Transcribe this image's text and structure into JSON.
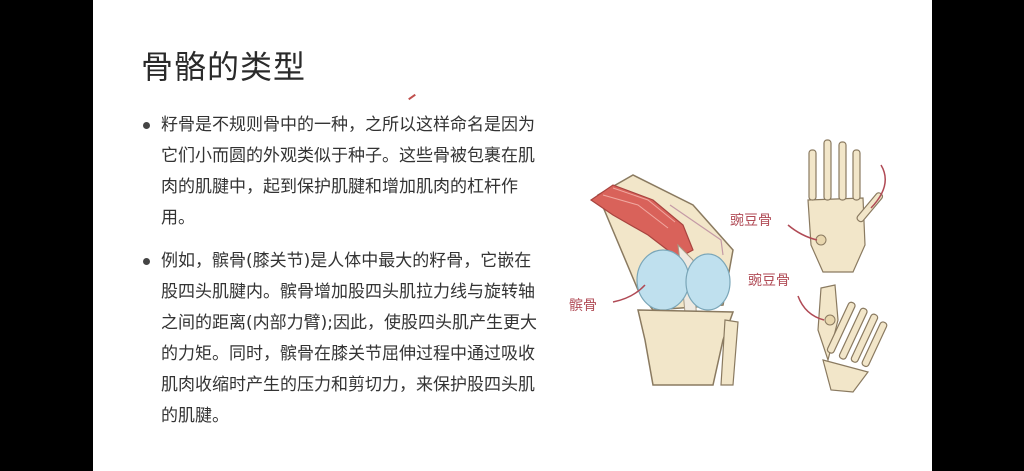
{
  "slide": {
    "title": "骨骼的类型",
    "bullets": [
      "籽骨是不规则骨中的一种，之所以这样命名是因为它们小而圆的外观类似于种子。这些骨被包裹在肌肉的肌腱中，起到保护肌腱和增加肌肉的杠杆作用。",
      "例如，髌骨(膝关节)是人体中最大的籽骨，它嵌在股四头肌腱内。髌骨增加股四头肌拉力线与旋转轴之间的距离(内部力臂);因此，使股四头肌产生更大的力矩。同时，髌骨在膝关节屈伸过程中通过吸收肌肉收缩时产生的压力和剪切力，来保护股四头肌的肌腱。"
    ]
  },
  "illustration": {
    "knee_label": "髌骨",
    "hand_label": "豌豆骨",
    "foot_label": "豌豆骨",
    "bone_color": "#f2e6c9",
    "muscle_color": "#d9625a",
    "cartilage_color": "#bfe0ee",
    "label_color": "#b04a55"
  }
}
